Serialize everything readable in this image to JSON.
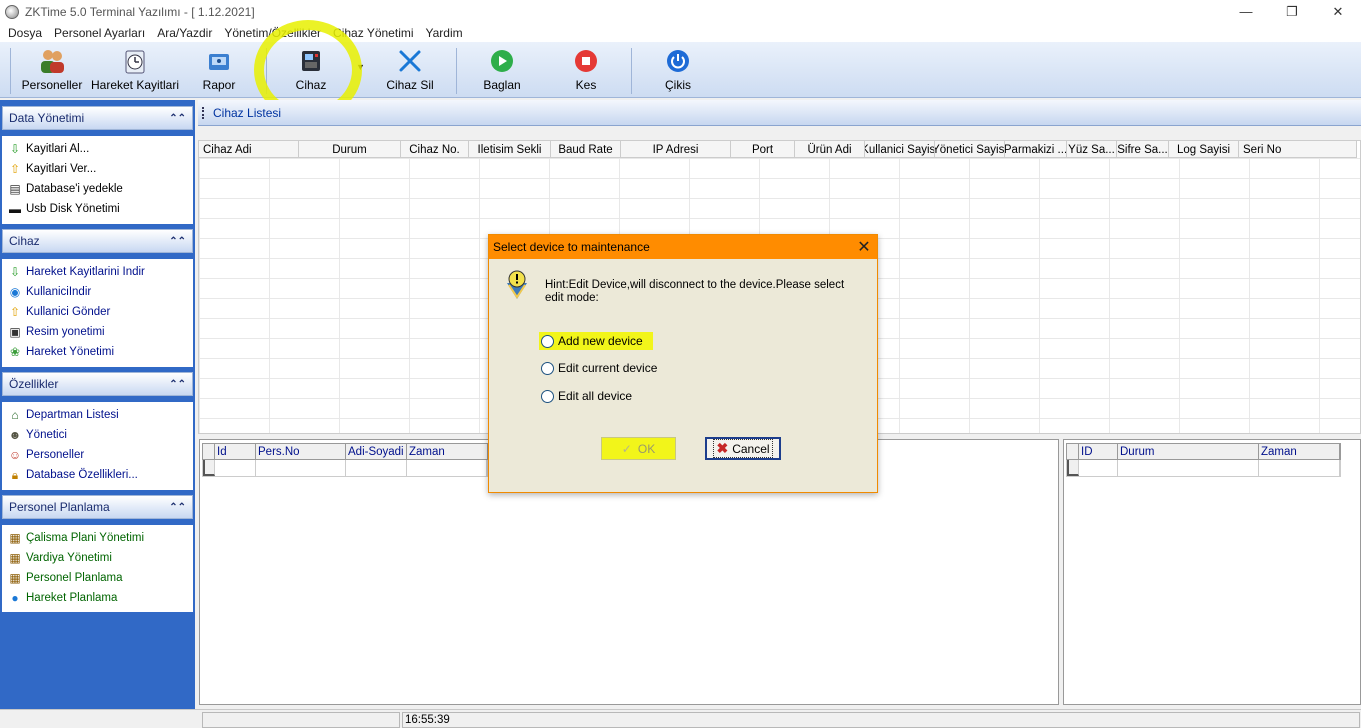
{
  "window": {
    "title": "ZKTime 5.0 Terminal Yazılımı - [  1.12.2021]",
    "controls": [
      "—",
      "❐",
      "✕"
    ]
  },
  "menu": [
    "Dosya",
    "Personel Ayarları",
    "Ara/Yazdir",
    "Yönetim/Özellikler",
    "Cihaz Yönetimi",
    "Yardim"
  ],
  "toolbar": {
    "personeller": "Personeller",
    "hareket": "Hareket Kayitlari",
    "rapor": "Rapor",
    "cihaz": "Cihaz",
    "cihaz_sil": "Cihaz Sil",
    "baglan": "Baglan",
    "kes": "Kes",
    "cikis": "Çikis"
  },
  "sidebar": {
    "groups": [
      {
        "title": "Data Yönetimi",
        "items": [
          "Kayitlari Al...",
          "Kayitlari Ver...",
          "Database'i yedekle",
          "Usb Disk Yönetimi"
        ]
      },
      {
        "title": "Cihaz",
        "items": [
          "Hareket Kayitlarini Indir",
          "KullaniciIndir",
          "Kullanici Gönder",
          "Resim yonetimi",
          "Hareket Yönetimi"
        ]
      },
      {
        "title": "Özellikler",
        "items": [
          "Departman Listesi",
          "Yönetici",
          "Personeller",
          "Database Özellikleri..."
        ]
      },
      {
        "title": "Personel Planlama",
        "items": [
          "Çalisma Plani Yönetimi",
          "Vardiya Yönetimi",
          "Personel Planlama",
          "Hareket Planlama"
        ]
      }
    ]
  },
  "main": {
    "header": "Cihaz Listesi",
    "columns": [
      "Cihaz Adi",
      "Durum",
      "Cihaz No.",
      "Iletisim Sekli",
      "Baud Rate",
      "IP Adresi",
      "Port",
      "Ürün Adi",
      "Kullanici Sayisi",
      "Yönetici Sayisi",
      "Parmakizi ...",
      "Yüz Sa...",
      "Sifre Sa...",
      "Log Sayisi",
      "Seri No"
    ]
  },
  "bottom_left": {
    "columns": [
      "Id",
      "Pers.No",
      "Adi-Soyadi",
      "Zaman"
    ]
  },
  "bottom_right": {
    "columns": [
      "ID",
      "Durum",
      "Zaman"
    ]
  },
  "statusbar": {
    "time": "16:55:39"
  },
  "dialog": {
    "title": "Select device to maintenance",
    "hint": "Hint:Edit Device,will disconnect to the device.Please select edit mode:",
    "options": [
      "Add new device",
      "Edit current device",
      "Edit all device"
    ],
    "ok": "OK",
    "cancel": "Cancel"
  },
  "colors": {
    "dialog_title": "#ff8c00",
    "highlight": "#f2f51a",
    "sidebar_bg": "#3169c6"
  }
}
